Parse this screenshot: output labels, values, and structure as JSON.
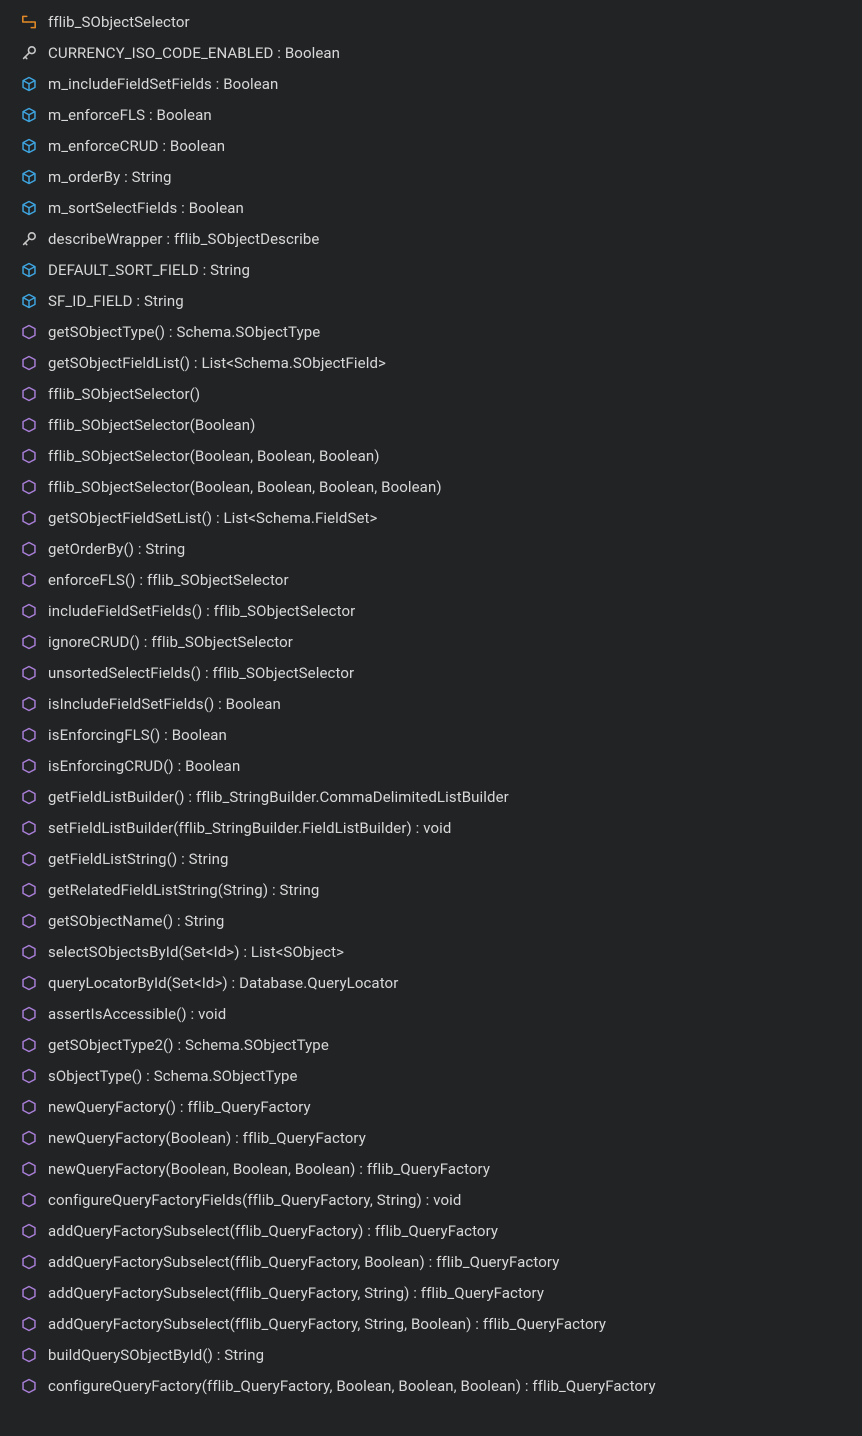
{
  "outline": {
    "items": [
      {
        "icon": "class",
        "label": "fflib_SObjectSelector"
      },
      {
        "icon": "property",
        "label": "CURRENCY_ISO_CODE_ENABLED : Boolean"
      },
      {
        "icon": "field",
        "label": "m_includeFieldSetFields : Boolean"
      },
      {
        "icon": "field",
        "label": "m_enforceFLS : Boolean"
      },
      {
        "icon": "field",
        "label": "m_enforceCRUD : Boolean"
      },
      {
        "icon": "field",
        "label": "m_orderBy : String"
      },
      {
        "icon": "field",
        "label": "m_sortSelectFields : Boolean"
      },
      {
        "icon": "property",
        "label": "describeWrapper : fflib_SObjectDescribe"
      },
      {
        "icon": "field",
        "label": "DEFAULT_SORT_FIELD : String"
      },
      {
        "icon": "field",
        "label": "SF_ID_FIELD : String"
      },
      {
        "icon": "method",
        "label": "getSObjectType() : Schema.SObjectType"
      },
      {
        "icon": "method",
        "label": "getSObjectFieldList() : List<Schema.SObjectField>"
      },
      {
        "icon": "method",
        "label": "fflib_SObjectSelector()"
      },
      {
        "icon": "method",
        "label": "fflib_SObjectSelector(Boolean)"
      },
      {
        "icon": "method",
        "label": "fflib_SObjectSelector(Boolean, Boolean, Boolean)"
      },
      {
        "icon": "method",
        "label": "fflib_SObjectSelector(Boolean, Boolean, Boolean, Boolean)"
      },
      {
        "icon": "method",
        "label": "getSObjectFieldSetList() : List<Schema.FieldSet>"
      },
      {
        "icon": "method",
        "label": "getOrderBy() : String"
      },
      {
        "icon": "method",
        "label": "enforceFLS() : fflib_SObjectSelector"
      },
      {
        "icon": "method",
        "label": "includeFieldSetFields() : fflib_SObjectSelector"
      },
      {
        "icon": "method",
        "label": "ignoreCRUD() : fflib_SObjectSelector"
      },
      {
        "icon": "method",
        "label": "unsortedSelectFields() : fflib_SObjectSelector"
      },
      {
        "icon": "method",
        "label": "isIncludeFieldSetFields() : Boolean"
      },
      {
        "icon": "method",
        "label": "isEnforcingFLS() : Boolean"
      },
      {
        "icon": "method",
        "label": "isEnforcingCRUD() : Boolean"
      },
      {
        "icon": "method",
        "label": "getFieldListBuilder() : fflib_StringBuilder.CommaDelimitedListBuilder"
      },
      {
        "icon": "method",
        "label": "setFieldListBuilder(fflib_StringBuilder.FieldListBuilder) : void"
      },
      {
        "icon": "method",
        "label": "getFieldListString() : String"
      },
      {
        "icon": "method",
        "label": "getRelatedFieldListString(String) : String"
      },
      {
        "icon": "method",
        "label": "getSObjectName() : String"
      },
      {
        "icon": "method",
        "label": "selectSObjectsById(Set<Id>) : List<SObject>"
      },
      {
        "icon": "method",
        "label": "queryLocatorById(Set<Id>) : Database.QueryLocator"
      },
      {
        "icon": "method",
        "label": "assertIsAccessible() : void"
      },
      {
        "icon": "method",
        "label": "getSObjectType2() : Schema.SObjectType"
      },
      {
        "icon": "method",
        "label": "sObjectType() : Schema.SObjectType"
      },
      {
        "icon": "method",
        "label": "newQueryFactory() : fflib_QueryFactory"
      },
      {
        "icon": "method",
        "label": "newQueryFactory(Boolean) : fflib_QueryFactory"
      },
      {
        "icon": "method",
        "label": "newQueryFactory(Boolean, Boolean, Boolean) : fflib_QueryFactory"
      },
      {
        "icon": "method",
        "label": "configureQueryFactoryFields(fflib_QueryFactory, String) : void"
      },
      {
        "icon": "method",
        "label": "addQueryFactorySubselect(fflib_QueryFactory) : fflib_QueryFactory"
      },
      {
        "icon": "method",
        "label": "addQueryFactorySubselect(fflib_QueryFactory, Boolean) : fflib_QueryFactory"
      },
      {
        "icon": "method",
        "label": "addQueryFactorySubselect(fflib_QueryFactory, String) : fflib_QueryFactory"
      },
      {
        "icon": "method",
        "label": "addQueryFactorySubselect(fflib_QueryFactory, String, Boolean) : fflib_QueryFactory"
      },
      {
        "icon": "method",
        "label": "buildQuerySObjectById() : String"
      },
      {
        "icon": "method",
        "label": "configureQueryFactory(fflib_QueryFactory, Boolean, Boolean, Boolean) : fflib_QueryFactory"
      }
    ]
  },
  "icon_colors": {
    "class": "#e08926",
    "property": "#c7c7c7",
    "field": "#3ea5e0",
    "method": "#a97fd8"
  }
}
